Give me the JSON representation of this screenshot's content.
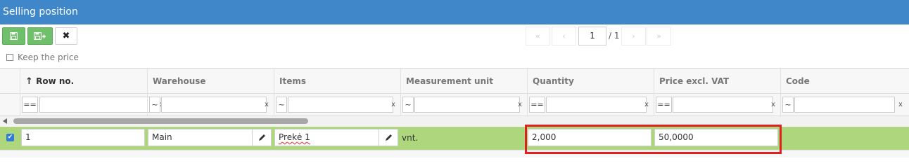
{
  "window": {
    "title": "Selling position"
  },
  "toolbar": {
    "save_icon": "save-icon",
    "save_add_icon": "save-add-icon",
    "close_label": "✖"
  },
  "pager": {
    "first": "«",
    "prev": "‹",
    "page": "1",
    "total": "/ 1",
    "next": "›",
    "last": "»"
  },
  "options": {
    "keep_price_label": "Keep the price",
    "keep_price_checked": false
  },
  "table": {
    "columns": [
      {
        "label": "Row no.",
        "sort": "ascending"
      },
      {
        "label": "Warehouse"
      },
      {
        "label": "Items"
      },
      {
        "label": "Measurement unit"
      },
      {
        "label": "Quantity"
      },
      {
        "label": "Price excl. VAT"
      },
      {
        "label": "Code"
      }
    ],
    "filters": [
      {
        "op": "==",
        "value": ""
      },
      {
        "op": "~",
        "value": ""
      },
      {
        "op": "~",
        "value": ""
      },
      {
        "op": "~",
        "value": ""
      },
      {
        "op": "==",
        "value": ""
      },
      {
        "op": "==",
        "value": ""
      },
      {
        "op": "~",
        "value": ""
      }
    ],
    "filter_clear": "x",
    "rows": [
      {
        "selected": true,
        "row_no": "1",
        "warehouse": "Main",
        "item": "Prekė 1",
        "unit": "vnt.",
        "quantity": "2,000",
        "price": "50,0000",
        "code": ""
      }
    ]
  },
  "colors": {
    "title_bar": "#3f87c8",
    "selected_row": "#aed67c",
    "highlight": "#e02020",
    "primary_button": "#6fbf6b"
  }
}
